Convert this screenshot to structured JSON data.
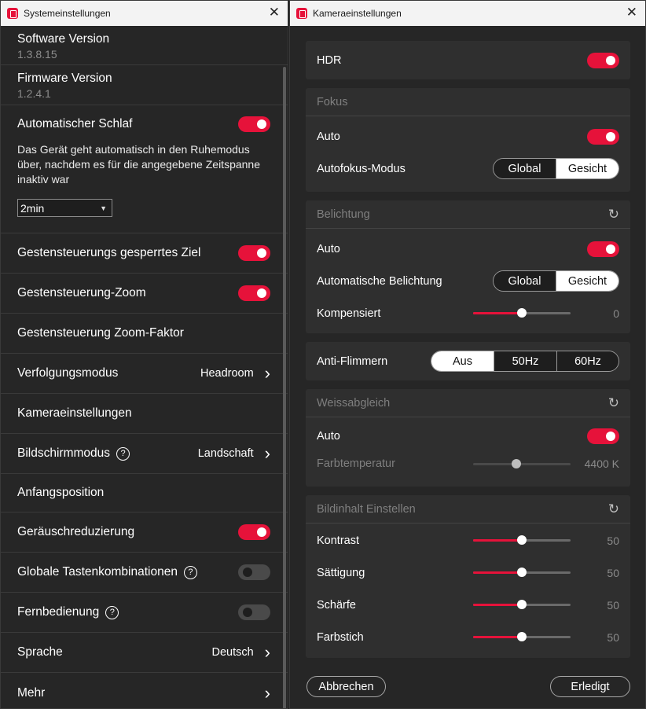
{
  "left_window": {
    "title": "Systemeinstellungen",
    "software": {
      "label": "Software Version",
      "value": "1.3.8.15"
    },
    "firmware": {
      "label": "Firmware Version",
      "value": "1.2.4.1"
    },
    "auto_sleep": {
      "label": "Automatischer Schlaf",
      "description": "Das Gerät geht automatisch in den Ruhemodus über, nachdem es für die angegebene Zeitspanne inaktiv war",
      "dropdown_value": "2min",
      "on": true
    },
    "rows": {
      "gesture_lock": {
        "label": "Gestensteuerungs gesperrtes Ziel",
        "on": true
      },
      "gesture_zoom": {
        "label": "Gestensteuerung-Zoom",
        "on": true
      },
      "zoom_factor": {
        "label": "Gestensteuerung Zoom-Faktor"
      },
      "tracking": {
        "label": "Verfolgungsmodus",
        "value": "Headroom"
      },
      "camera": {
        "label": "Kameraeinstellungen"
      },
      "screen_mode": {
        "label": "Bildschirmmodus",
        "value": "Landschaft"
      },
      "start_pos": {
        "label": "Anfangsposition"
      },
      "noise": {
        "label": "Geräuschreduzierung",
        "on": true
      },
      "shortcuts": {
        "label": "Globale Tastenkombinationen",
        "on": false
      },
      "remote": {
        "label": "Fernbedienung",
        "on": false
      },
      "language": {
        "label": "Sprache",
        "value": "Deutsch"
      },
      "more": {
        "label": "Mehr"
      }
    },
    "help_glyph": "?",
    "chevron_glyph": "›"
  },
  "right_window": {
    "title": "Kameraeinstellungen",
    "hdr": {
      "label": "HDR",
      "on": true
    },
    "focus": {
      "header": "Fokus",
      "auto_label": "Auto",
      "auto_on": true,
      "mode_label": "Autofokus-Modus",
      "options": [
        "Global",
        "Gesicht"
      ],
      "selected": "Gesicht"
    },
    "exposure": {
      "header": "Belichtung",
      "auto_label": "Auto",
      "auto_on": true,
      "mode_label": "Automatische Belichtung",
      "options": [
        "Global",
        "Gesicht"
      ],
      "selected": "Gesicht",
      "comp_label": "Kompensiert",
      "comp_value": "0",
      "comp_fraction": 0.5
    },
    "antiflicker": {
      "label": "Anti-Flimmern",
      "options": [
        "Aus",
        "50Hz",
        "60Hz"
      ],
      "selected": "Aus"
    },
    "white_balance": {
      "header": "Weissabgleich",
      "auto_label": "Auto",
      "auto_on": true,
      "temp_label": "Farbtemperatur",
      "temp_value": "4400 K",
      "temp_fraction": 0.44
    },
    "image": {
      "header": "Bildinhalt Einstellen",
      "items": [
        {
          "label": "Kontrast",
          "value": "50",
          "fraction": 0.5
        },
        {
          "label": "Sättigung",
          "value": "50",
          "fraction": 0.5
        },
        {
          "label": "Schärfe",
          "value": "50",
          "fraction": 0.5
        },
        {
          "label": "Farbstich",
          "value": "50",
          "fraction": 0.5
        }
      ]
    },
    "cancel_label": "Abbrechen",
    "done_label": "Erledigt"
  },
  "glyphs": {
    "close": "✕",
    "caret": "▼",
    "refresh": "↻"
  },
  "colors": {
    "accent": "#e6123a",
    "panel": "#262626",
    "card": "#2f2f2f"
  }
}
